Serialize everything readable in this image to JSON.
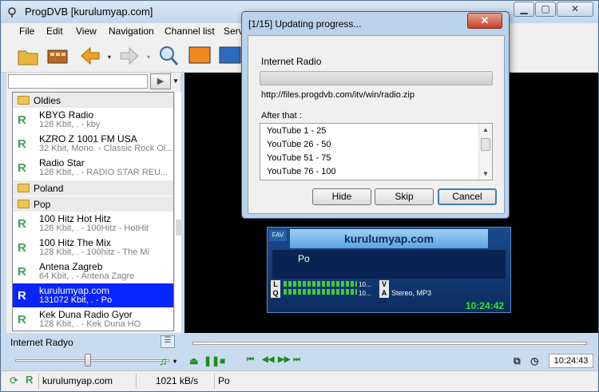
{
  "window": {
    "title": "ProgDVB [kurulumyap.com]"
  },
  "menu": [
    "File",
    "Edit",
    "View",
    "Navigation",
    "Channel list",
    "Serv"
  ],
  "toolbar_icons": [
    "open-folder-icon",
    "film-icon",
    "back-arrow-icon",
    "forward-arrow-icon",
    "search-icon",
    "screen-1-icon",
    "screen-2-icon"
  ],
  "channels": {
    "groups": [
      {
        "name": "Oldies",
        "items": [
          {
            "name": "KBYG Radio",
            "desc": "128 Kbit, . - kby"
          },
          {
            "name": "KZRO Z 1001 FM USA",
            "desc": "32 Kbit, Mono. - Classic Rock Ol..."
          },
          {
            "name": "Radio Star",
            "desc": "128 Kbit, . - RADIO STAR REU..."
          }
        ]
      },
      {
        "name": "Poland",
        "items": []
      },
      {
        "name": "Pop",
        "items": [
          {
            "name": "100 Hitz Hot Hitz",
            "desc": "128 Kbit, . - 100Hitz - HotHit"
          },
          {
            "name": "100 Hitz The Mix",
            "desc": "128 Kbit, . - 100hitz - The Mi"
          },
          {
            "name": "Antena Zagreb",
            "desc": "64 Kbit, . - Antena Zagre"
          },
          {
            "name": "kurulumyap.com",
            "desc": "131072 Kbit, . - Po"
          },
          {
            "name": "Kek Duna Radio Gyor",
            "desc": "128 Kbit, . - Kek Duna HO"
          }
        ]
      }
    ],
    "selected": "kurulumyap.com"
  },
  "osd": {
    "tag": "FAV",
    "channel": "kurulumyap.com",
    "program": "Po",
    "l_label": "L",
    "q_label": "Q",
    "v_label": "V",
    "a_label": "A",
    "levels": [
      "10...",
      "10..."
    ],
    "format": "Stereo, MP3",
    "clock": "10:24:42"
  },
  "status": {
    "group_name": "Internet Radyo",
    "time": "10:24:43",
    "channel": "kurulumyap.com",
    "rate": "1021 kB/s",
    "program": "Po"
  },
  "dialog": {
    "title": "[1/15] Updating progress...",
    "current": "Internet Radio",
    "url": "http://files.progdvb.com/itv/win/radio.zip",
    "after_label": "After that :",
    "queue": [
      "YouTube 1 - 25",
      "YouTube 26 - 50",
      "YouTube 51 - 75",
      "YouTube 76 - 100"
    ],
    "hide": "Hide",
    "skip": "Skip",
    "cancel": "Cancel"
  },
  "colors": {
    "selection": "#0a24ff",
    "radio_icon": "#3aa055",
    "clock": "#32e632"
  }
}
